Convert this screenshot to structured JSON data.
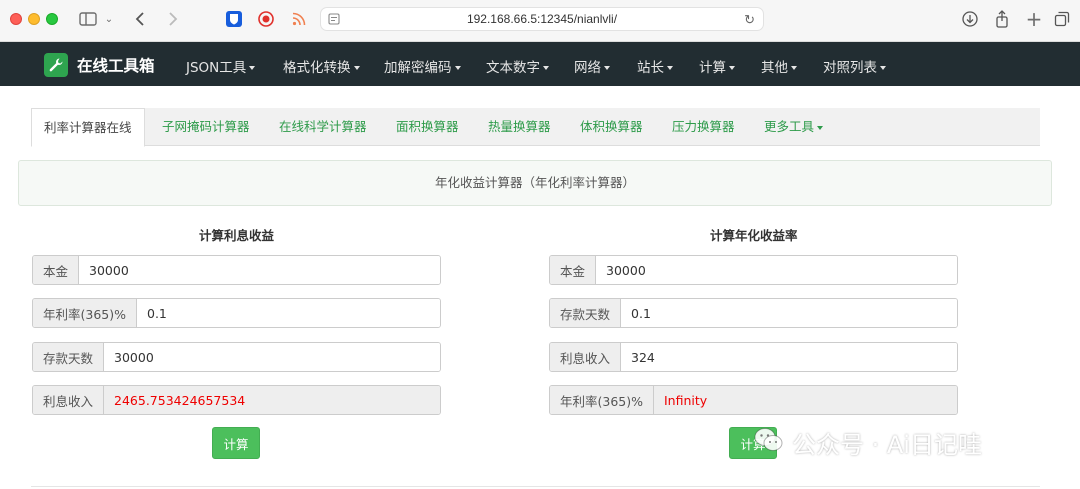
{
  "browser": {
    "url": "192.168.66.5:12345/nianlvli/"
  },
  "navbar": {
    "brand": "在线工具箱",
    "items": [
      "JSON工具",
      "格式化转换",
      "加解密编码",
      "文本数字",
      "网络",
      "站长",
      "计算",
      "其他",
      "对照列表"
    ]
  },
  "tabs": [
    "利率计算器在线",
    "子网掩码计算器",
    "在线科学计算器",
    "面积换算器",
    "热量换算器",
    "体积换算器",
    "压力换算器",
    "更多工具"
  ],
  "banner": "年化收益计算器（年化利率计算器）",
  "left": {
    "title": "计算利息收益",
    "fields": [
      {
        "label": "本金",
        "value": "30000"
      },
      {
        "label": "年利率(365)%",
        "value": "0.1"
      },
      {
        "label": "存款天数",
        "value": "30000"
      },
      {
        "label": "利息收入",
        "value": "2465.753424657534"
      }
    ],
    "button": "计算"
  },
  "right": {
    "title": "计算年化收益率",
    "fields": [
      {
        "label": "本金",
        "value": "30000"
      },
      {
        "label": "存款天数",
        "value": "0.1"
      },
      {
        "label": "利息收入",
        "value": "324"
      },
      {
        "label": "年利率(365)%",
        "value": "Infinity"
      }
    ],
    "button": "计算"
  },
  "watermark": "公众号 · Ai日记哇",
  "colors": {
    "navbar": "#222d32",
    "accent_green": "#4cbf5c",
    "link_green": "#2e9b4a",
    "result_red": "#e00000"
  }
}
